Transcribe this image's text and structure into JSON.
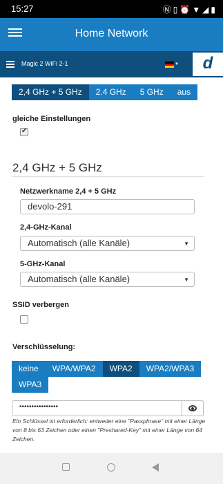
{
  "status_bar": {
    "time": "15:27",
    "icons": [
      "nfc-icon",
      "vibrate-icon",
      "alarm-icon",
      "wifi-icon",
      "signal-icon",
      "battery-icon"
    ]
  },
  "app_bar": {
    "title": "Home Network"
  },
  "device_bar": {
    "device_name": "Magic 2 WiFi 2-1",
    "logo": "d"
  },
  "band_tabs": [
    {
      "label": "2,4 GHz + 5 GHz",
      "active": true
    },
    {
      "label": "2.4 GHz",
      "active": false
    },
    {
      "label": "5 GHz",
      "active": false
    },
    {
      "label": "aus",
      "active": false
    }
  ],
  "same_settings": {
    "label": "gleiche Einstellungen",
    "checked": true
  },
  "section": {
    "title": "2,4 GHz + 5 GHz"
  },
  "network_name": {
    "label": "Netzwerkname 2,4 + 5 GHz",
    "value": "devolo-291"
  },
  "channel_24": {
    "label": "2,4-GHz-Kanal",
    "value": "Automatisch (alle Kanäle)"
  },
  "channel_5": {
    "label": "5-GHz-Kanal",
    "value": "Automatisch (alle Kanäle)"
  },
  "hide_ssid": {
    "label": "SSID verbergen",
    "checked": false
  },
  "encryption": {
    "label": "Verschlüsselung:",
    "options": [
      {
        "label": "keine",
        "active": false
      },
      {
        "label": "WPA/WPA2",
        "active": false
      },
      {
        "label": "WPA2",
        "active": true
      },
      {
        "label": "WPA2/WPA3",
        "active": false
      },
      {
        "label": "WPA3",
        "active": false
      }
    ]
  },
  "password": {
    "masked_value": "••••••••••••••••",
    "hint": "Ein Schlüssel ist erforderlich: entweder eine \"Passphrase\" mit einer Länge von 8 bis 63 Zeichen oder einen \"Preshared-Key\" mit einer Länge von 64 Zeichen."
  },
  "colors": {
    "primary": "#1a7dc2",
    "dark": "#0e4f7e"
  }
}
